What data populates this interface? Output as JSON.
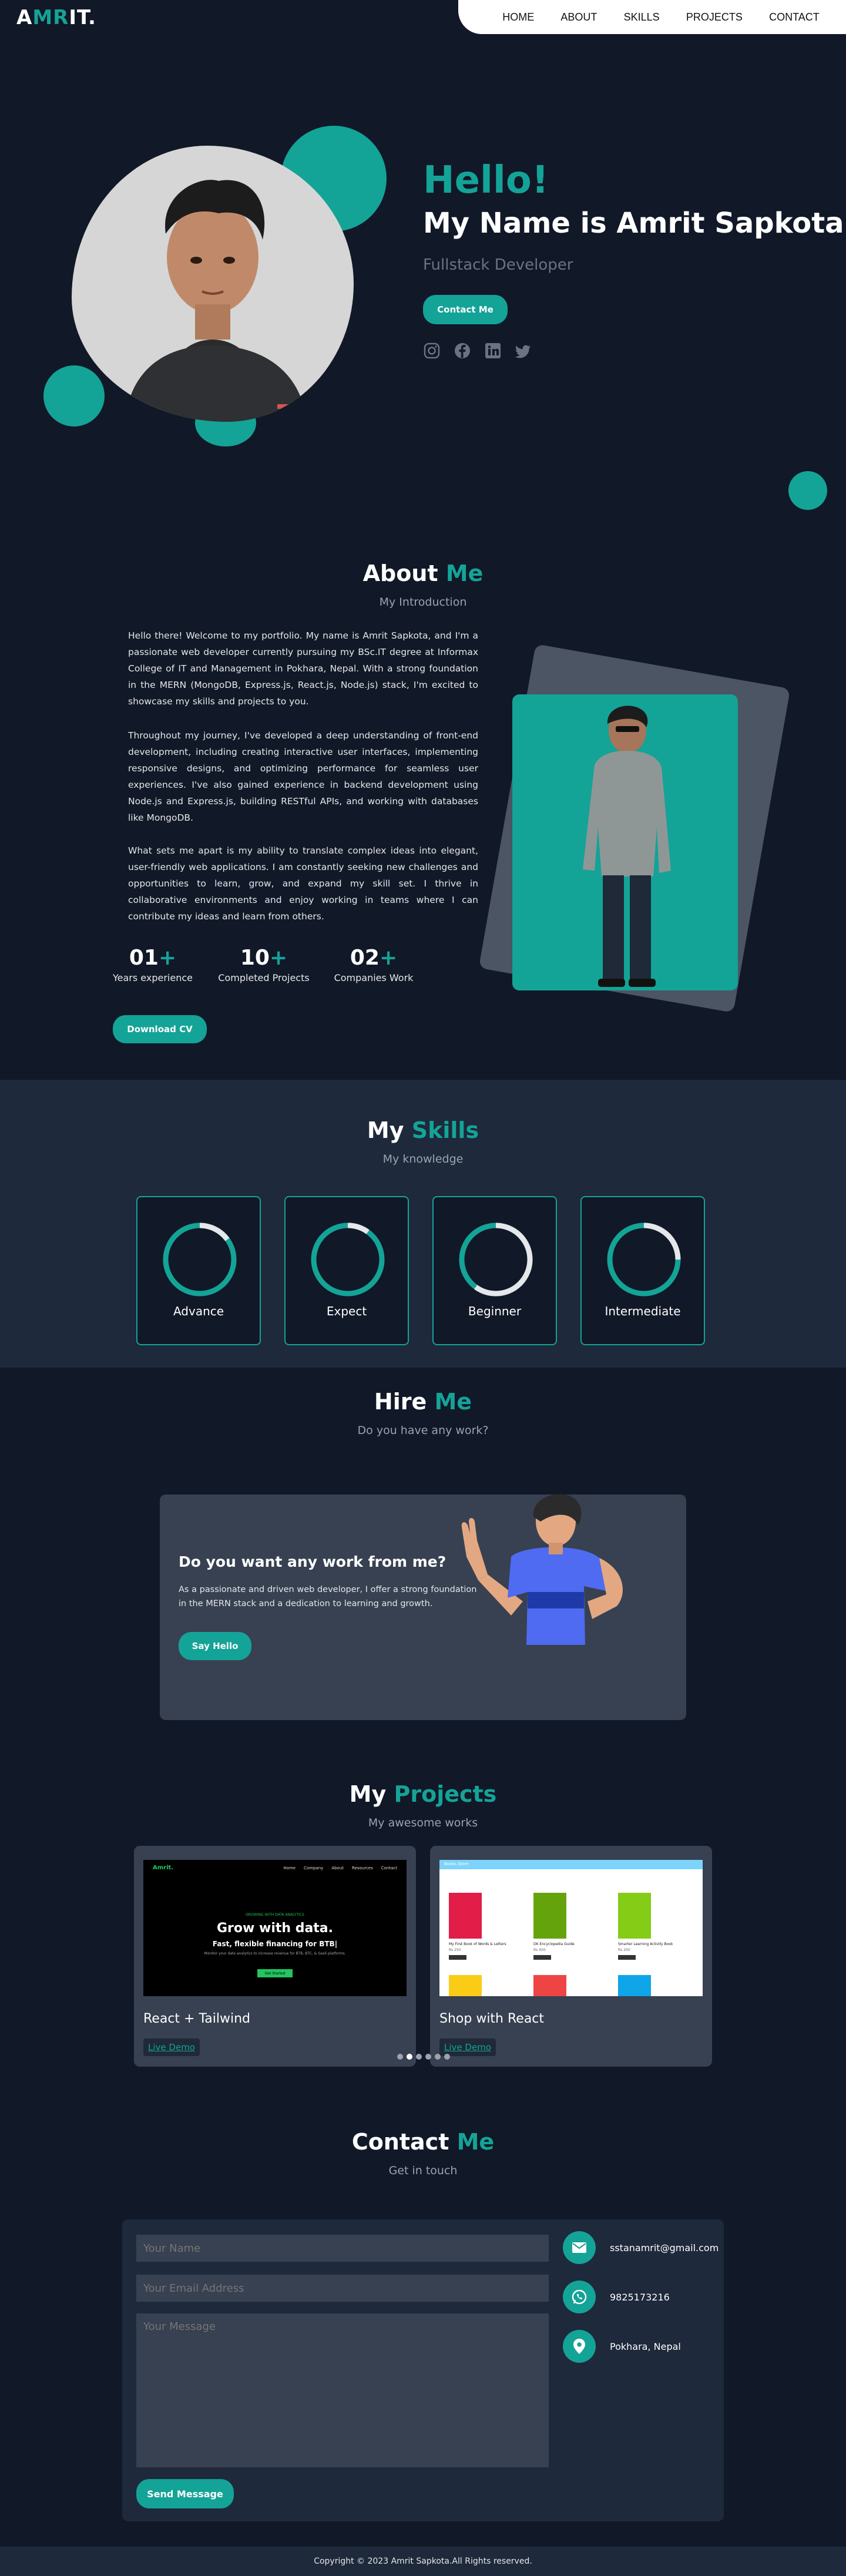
{
  "nav": {
    "logo_a": "A",
    "logo_mr": "MR",
    "logo_it": "IT.",
    "links": [
      "HOME",
      "ABOUT",
      "SKILLS",
      "PROJECTS",
      "CONTACT"
    ]
  },
  "hero": {
    "hello": "Hello!",
    "name": "My Name is Amrit Sapkota",
    "role": "Fullstack Developer",
    "contact_button": "Contact Me",
    "socials": [
      "instagram-icon",
      "facebook-icon",
      "linkedin-icon",
      "twitter-icon"
    ]
  },
  "about": {
    "title_a": "About",
    "title_b": "Me",
    "subtitle": "My Introduction",
    "paragraphs": [
      "Hello there! Welcome to my portfolio. My name is Amrit Sapkota, and I'm a passionate web developer currently pursuing my BSc.IT degree at Informax College of IT and Management in Pokhara, Nepal. With a strong foundation in the MERN (MongoDB, Express.js, React.js, Node.js) stack, I'm excited to showcase my skills and projects to you.",
      "Throughout my journey, I've developed a deep understanding of front-end development, including creating interactive user interfaces, implementing responsive designs, and optimizing performance for seamless user experiences. I've also gained experience in backend development using Node.js and Express.js, building RESTful APIs, and working with databases like MongoDB.",
      "What sets me apart is my ability to translate complex ideas into elegant, user-friendly web applications. I am constantly seeking new challenges and opportunities to learn, grow, and expand my skill set. I thrive in collaborative environments and enjoy working in teams where I can contribute my ideas and learn from others."
    ],
    "stats": [
      {
        "num": "01",
        "label": "Years experience"
      },
      {
        "num": "10",
        "label": "Completed Projects"
      },
      {
        "num": "02",
        "label": "Companies Work"
      }
    ],
    "plus": "+",
    "cv_button": "Download CV"
  },
  "skills": {
    "title_a": "My",
    "title_b": "Skills",
    "subtitle": "My knowledge",
    "items": [
      {
        "label": "Advance",
        "level": 0.15
      },
      {
        "label": "Expect",
        "level": 0.1
      },
      {
        "label": "Beginner",
        "level": 0.6
      },
      {
        "label": "Intermediate",
        "level": 0.25
      }
    ]
  },
  "hire": {
    "title_a": "Hire",
    "title_b": "Me",
    "subtitle": "Do you have any work?",
    "heading": "Do you want any work from me?",
    "body": "As a passionate and driven web developer, I offer a strong foundation in the MERN stack and a dedication to learning and growth.",
    "button": "Say Hello"
  },
  "projects": {
    "title_a": "My",
    "title_b": "Projects",
    "subtitle": "My awesome works",
    "items": [
      {
        "title": "React + Tailwind",
        "link": "Live Demo",
        "shot": {
          "logo": "Amrit.",
          "menu": [
            "Home",
            "Company",
            "About",
            "Resources",
            "Contact"
          ],
          "kicker": "GROWING WITH DATA ANALYTICS",
          "h1": "Grow with data.",
          "h2": "Fast, flexible financing for BTB|",
          "p": "Monitor your data analytics to increase revenue for BTB, BTC, & SaaS platforms.",
          "btn": "Get Started"
        }
      },
      {
        "title": "Shop with React",
        "link": "Live Demo",
        "shot": {
          "brand": "Books Store",
          "books": [
            {
              "name": "My First Book of Words & Letters",
              "price": "Rs 250"
            },
            {
              "name": "DK Encyclopedia Guide",
              "price": "Rs 450"
            },
            {
              "name": "Smarter Learning Activity Book",
              "price": "Rs 200"
            }
          ]
        }
      }
    ],
    "dots": 6
  },
  "contact": {
    "title_a": "Contact",
    "title_b": "Me",
    "subtitle": "Get in touch",
    "name_ph": "Your Name",
    "email_ph": "Your Email Address",
    "message_ph": "Your Message",
    "send_button": "Send Message",
    "email": "sstanamrit@gmail.com",
    "phone": "9825173216",
    "location": "Pokhara, Nepal"
  },
  "footer": {
    "text": "Copyright © 2023 Amrit Sapkota.All Rights reserved."
  },
  "colors": {
    "accent": "#14A397",
    "background": "#111827",
    "band": "#1e293b",
    "card": "#374151"
  }
}
